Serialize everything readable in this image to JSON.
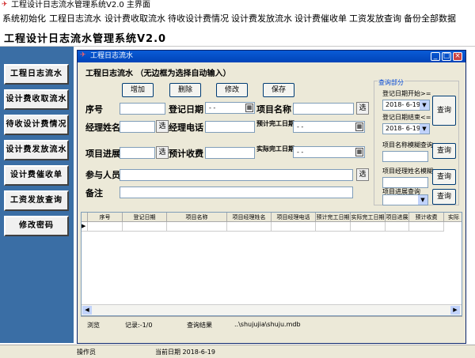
{
  "app": {
    "window_title": "工程设计日志流水管理系统V2.0  主界面",
    "header_title": "工程设计日志流水管理系统V2.0"
  },
  "menu": [
    "系统初始化",
    "工程日志流水",
    "设计费收取流水",
    "待收设计费情况",
    "设计费发放流水",
    "设计费催收单",
    "工资发放查询",
    "备份全部数据"
  ],
  "sidebar": [
    "工程日志流水",
    "设计费收取流水",
    "待收设计费情况",
    "设计费发放流水",
    "设计费催收单",
    "工资发放查询",
    "修改密码"
  ],
  "inner_window": {
    "title": "工程日志流水",
    "heading": "工程日志流水 （无边框为选择自动输入）",
    "buttons": {
      "add": "增加",
      "delete": "删除",
      "modify": "修改",
      "save": "保存"
    },
    "labels": {
      "seq": "序号",
      "reg_date": "登记日期",
      "project_name": "项目名称",
      "manager": "经理姓名",
      "manager_phone": "经理电话",
      "est_date": "预计完工日期",
      "progress": "项目进展",
      "est_fee": "预计收费",
      "actual_date": "实际完工日期",
      "participants": "参与人员",
      "remark": "备注"
    },
    "select_label": "选",
    "date_placeholder": "- -",
    "query": {
      "group": "查询部分",
      "reg_start": "登记日期开始>=",
      "reg_end": "登记日期结束<=",
      "start_value": "2018- 6-19",
      "end_value": "2018- 6-19",
      "name_query": "项目名称模糊查询",
      "manager_query": "项目经理姓名模糊",
      "progress_query": "项目进展查询",
      "btn": "查询"
    },
    "columns": [
      "序号",
      "登记日期",
      "项目名称",
      "项目经理姓名",
      "项目经理电话",
      "预计完工日期",
      "实际完工日期",
      "项目进展",
      "预计收费",
      "实际"
    ],
    "status": {
      "browse": "浏览",
      "record": "记录:-1/0",
      "query_result": "查询结果",
      "path": "..\\shujujia\\shuju.mdb"
    }
  },
  "bottom": {
    "operator": "操作员",
    "date_label": "当前日期 2018-6-19"
  },
  "colors": {
    "sidebar_bg": "#3a6ea5",
    "title_blue": "#0a5bd6",
    "window_bg": "#ece9d8"
  }
}
